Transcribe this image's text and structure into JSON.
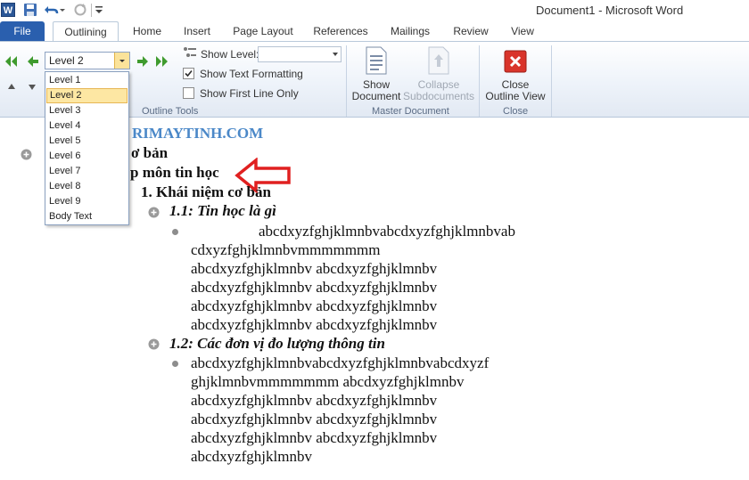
{
  "window": {
    "title": "Document1  -  Microsoft Word",
    "app_icon_letter": "W"
  },
  "tabs": [
    "File",
    "Outlining",
    "Home",
    "Insert",
    "Page Layout",
    "References",
    "Mailings",
    "Review",
    "View"
  ],
  "outline_tools": {
    "group_label": "Outline Tools",
    "level_value": "Level 2",
    "show_level_label": "Show Level:",
    "show_level_value": "",
    "show_text_formatting": "Show Text Formatting",
    "show_text_formatting_checked": true,
    "show_first_line_only": "Show First Line Only",
    "show_first_line_only_checked": false
  },
  "master_document": {
    "group_label": "Master Document",
    "show_document": [
      "Show",
      "Document"
    ],
    "collapse_subdocuments": [
      "Collapse",
      "Subdocuments"
    ]
  },
  "close_group": {
    "group_label": "Close",
    "close_outline_view": [
      "Close",
      "Outline View"
    ]
  },
  "level_menu": {
    "items": [
      "Level 1",
      "Level 2",
      "Level 3",
      "Level 4",
      "Level 5",
      "Level 6",
      "Level 7",
      "Level 8",
      "Level 9",
      "Body Text"
    ],
    "selected_index": 1
  },
  "document": {
    "watermark": "RIMAYTINH.COM",
    "line_a": "ơ bản",
    "line_b": "p môn tin học",
    "heading_1": "1. Khái niệm cơ bản",
    "heading_1_1": "1.1: Tin học là gì",
    "body_1": [
      "abcdxyzfghjklmnbvabcdxyzfghjklmnbvab",
      "cdxyzfghjklmnbvmmmmmmm",
      "abcdxyzfghjklmnbv abcdxyzfghjklmnbv",
      "abcdxyzfghjklmnbv abcdxyzfghjklmnbv",
      "abcdxyzfghjklmnbv abcdxyzfghjklmnbv",
      "abcdxyzfghjklmnbv abcdxyzfghjklmnbv"
    ],
    "heading_1_2": "1.2: Các đơn vị đo lượng thông tin",
    "body_2": [
      "abcdxyzfghjklmnbvabcdxyzfghjklmnbvabcdxyzf",
      "ghjklmnbvmmmmmmm abcdxyzfghjklmnbv",
      "abcdxyzfghjklmnbv abcdxyzfghjklmnbv",
      "abcdxyzfghjklmnbv abcdxyzfghjklmnbv",
      "abcdxyzfghjklmnbv abcdxyzfghjklmnbv",
      "abcdxyzfghjklmnbv"
    ]
  },
  "colors": {
    "file_tab": "#2a5fae",
    "annotation_arrow": "#e02020",
    "watermark": "#4b88c8"
  }
}
